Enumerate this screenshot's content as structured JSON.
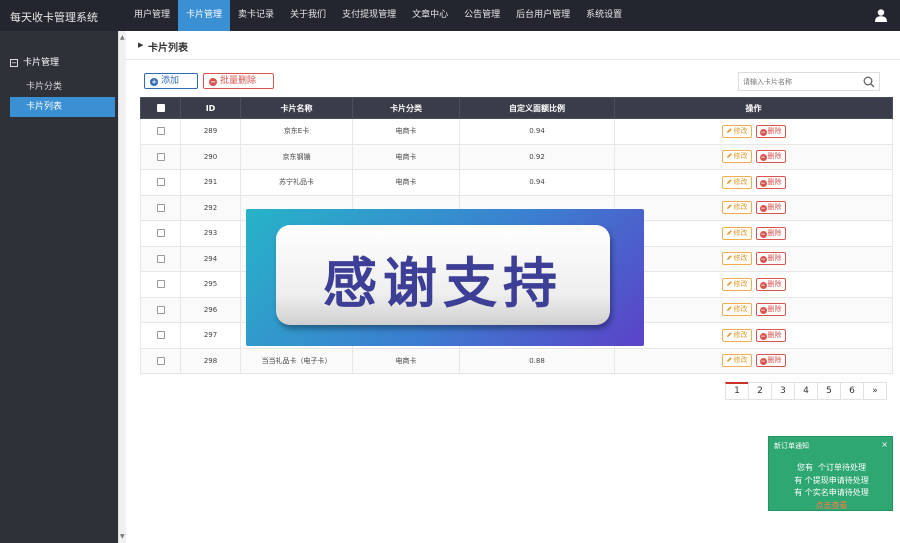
{
  "app": {
    "title": "每天收卡管理系统"
  },
  "nav": {
    "items": [
      "用户管理",
      "卡片管理",
      "卖卡记录",
      "关于我们",
      "支付提现管理",
      "文章中心",
      "公告管理",
      "后台用户管理",
      "系统设置"
    ]
  },
  "sidebar": {
    "group": "卡片管理",
    "items": [
      "卡片分类",
      "卡片列表"
    ]
  },
  "page": {
    "title": "卡片列表"
  },
  "toolbar": {
    "add_label": "添加",
    "add_icon": "plus-icon",
    "bulk_delete_label": "批量删除",
    "bulk_delete_icon": "minus-icon"
  },
  "search": {
    "placeholder": "请输入卡片名称",
    "icon": "search-icon"
  },
  "table": {
    "headers": [
      "ID",
      "卡片名称",
      "卡片分类",
      "自定义面额比例",
      "操作"
    ],
    "edit_label": "修改",
    "delete_label": "删除",
    "rows": [
      {
        "id": "289",
        "name": "京东E卡",
        "category": "电商卡",
        "ratio": "0.94"
      },
      {
        "id": "290",
        "name": "京东钢镚",
        "category": "电商卡",
        "ratio": "0.92"
      },
      {
        "id": "291",
        "name": "苏宁礼品卡",
        "category": "电商卡",
        "ratio": "0.94"
      },
      {
        "id": "292",
        "name": "",
        "category": "",
        "ratio": ""
      },
      {
        "id": "293",
        "name": "",
        "category": "",
        "ratio": ""
      },
      {
        "id": "294",
        "name": "",
        "category": "",
        "ratio": ""
      },
      {
        "id": "295",
        "name": "",
        "category": "",
        "ratio": ""
      },
      {
        "id": "296",
        "name": "",
        "category": "",
        "ratio": ""
      },
      {
        "id": "297",
        "name": "",
        "category": "",
        "ratio": ""
      },
      {
        "id": "298",
        "name": "当当礼品卡（电子卡）",
        "category": "电商卡",
        "ratio": "0.88"
      }
    ]
  },
  "pagination": {
    "pages": [
      "1",
      "2",
      "3",
      "4",
      "5",
      "6"
    ],
    "next": "»",
    "current": "1"
  },
  "overlay": {
    "text": "感谢支持"
  },
  "notice": {
    "title": "新订单通知",
    "close": "×",
    "line1_a": "您有",
    "line1_b": "个订单待处理",
    "line2": "有  个提现申请待处理",
    "line3": "有  个实名申请待处理",
    "link": "点击查看"
  },
  "colors": {
    "topbar": "#23262e",
    "accent": "#3b8fd3",
    "sidebar": "#2e3138",
    "notice": "#2fa772",
    "danger": "#d9534f",
    "warning": "#f0ad4e"
  }
}
